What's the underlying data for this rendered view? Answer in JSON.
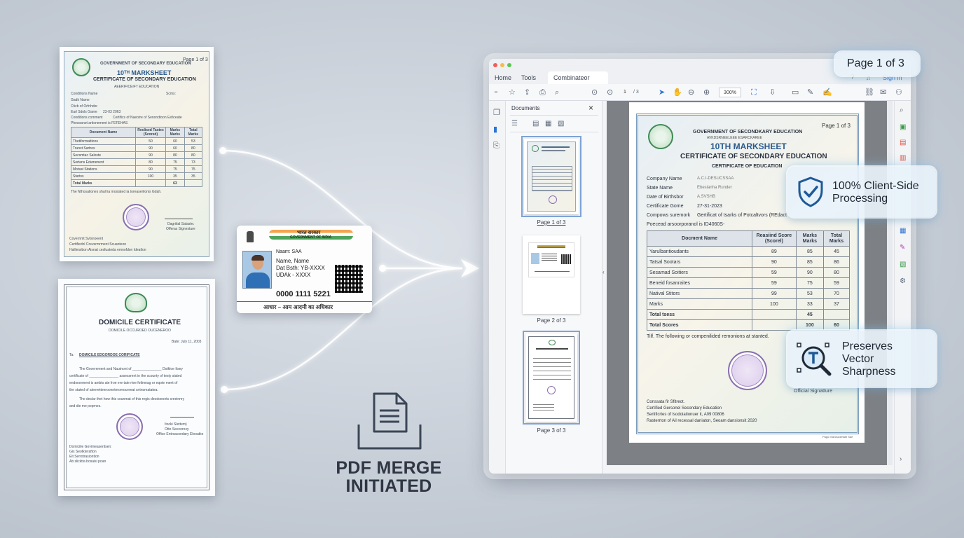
{
  "marksheet_doc": {
    "page": "Page 1 of 3",
    "gov": "GOVERNMENT OF SECONDARY EDUCATION",
    "title": "10ᵀᴴ MARKSHEET",
    "subtitle": "CERTIFICATE OF SECONDARY EDUCATION",
    "sub2": "AEERIFICEIFT EDUCATION",
    "fields": [
      {
        "label": "Conditions Name",
        "value": "",
        "label2": "Scms:"
      },
      {
        "label": "Gadk Name",
        "value": ""
      },
      {
        "label": "Cticb of Orfnhdor",
        "value": ""
      },
      {
        "label": "Earl Sdols Game",
        "value": "23-03 2063"
      },
      {
        "label": "Conditions comment",
        "value": "Certifics of Naeotre of Senondtoon Esficeate"
      }
    ],
    "note": "Phesoanot artionement is FEFEHAS",
    "table_headers": [
      "Document Name",
      "Reclised Tastes (Scored)",
      "Marks Marks",
      "Total Marks"
    ],
    "rows": [
      [
        "Thetiformattions",
        "50",
        "60",
        "53"
      ],
      [
        "Trunst Sartres",
        "90",
        "60",
        "80"
      ],
      [
        "Secsmtac Saloste",
        "90",
        "80",
        "80"
      ],
      [
        "Sertans Edumenent",
        "80",
        "75",
        "73"
      ],
      [
        "Motsat Stations",
        "90",
        "75",
        "75"
      ],
      [
        "Startss",
        "100",
        "35",
        "35"
      ],
      [
        "Total Marks",
        "",
        "63",
        ""
      ]
    ],
    "footnote": "The Nthosationes shall ia mostated ia toreaserilonis Gdah.",
    "signature_label": "Dagritial Salastrc",
    "signature_label2": "Offeras Signexture",
    "footer": [
      "Covernmt Svtsnoeent",
      "Certifiednl Crevermrment Scuanteon",
      "Hallimsibon Aisnat cesfuateda emnofdon Ideatlon"
    ]
  },
  "domicile_doc": {
    "title": "DOMICILE CERTIFICATE",
    "subtitle": "DOMICILE OCCUROED OUCENEROO",
    "date": "Bate: July 11, 2003",
    "to": "Ta:",
    "to_value": "DOMICILE EDGORDOE CORIFICATE",
    "body": [
      "The Government and Nautnont of _______________ Dotkloe Itsey",
      "certificate of _______________ assessrent in the scounty of testy stated",
      "endorsement is ambts ate froe ere tate rtee fotlmnag or eqote ment of",
      "the stated of ateeretteeroonnteromocereat sntnomatatea."
    ],
    "body2": [
      "The declar thet how this counmat of this regis deodoeoets sreeinnry",
      "and die me poprnes."
    ],
    "sig_label": "Itocki Slettem)",
    "sig_label2": "Otto Seeceroxy",
    "sig_label3": "Office Entrsacondary Elooatke",
    "footer": [
      "Domiciile Govimeaseritsen:",
      "Gis Seotkterafton",
      "Elt Serrotrasiontion",
      "Ab slicktta bosaisi poan"
    ]
  },
  "aadhaar": {
    "header_top": "भारत सरकार",
    "header_bottom": "GOVERNMENT OF INDIA",
    "name_line": "Naam: SAA",
    "name": "Name, Name",
    "dob": "Dat Bsth: YB-XXXX",
    "udai": "UDAk - XXXX",
    "number": "0000 1111 5221",
    "footer": "आधार – आम आदमी का अधिकार"
  },
  "caption": {
    "line1": "PDF MERGE",
    "line2": "INITIATED"
  },
  "window": {
    "tabs": [
      "Home",
      "Tools",
      "Combinateor A4..."
    ],
    "tab_close": "×",
    "signin": "Sign in",
    "page_input": "1",
    "page_total": "/ 3",
    "zoom": "300%",
    "panel_title": "Documents",
    "panel_close": "×",
    "thumbs": [
      "Page 1 of 3",
      "Page 2 of 3",
      "Page 3 of 3"
    ],
    "page": {
      "page_label": "Page 1 of 3",
      "gov": "GOVERNMENT OF SECONDKARY EDUCATION",
      "gov_sub": "AVKDSRNEELEEE ESARCKAREE",
      "title": "10TH MARKSHEET",
      "subtitle": "CERTIFICATE OF SECONDARY EDUCATION",
      "sub2": "CERTIFICATE OF EDUCATION",
      "fields": [
        {
          "label": "Company Name",
          "value": "A.C.I-DESUCSSAA"
        },
        {
          "label": "State Name",
          "value": "Ebeslanha Runder"
        },
        {
          "label": "Date of Birthsbor",
          "value": "A.SVSHB"
        },
        {
          "label": "Certificate Gome",
          "value": "27-31-2023"
        },
        {
          "label": "Compows suremork",
          "value": "Gertificat of tsarks of Potcaltvors (REdact"
        }
      ],
      "note": "Poecead arsoorporanol is ID4060S-",
      "table_headers": [
        "Docment Name",
        "Reasiind Score (Scorel)",
        "Marks Marks",
        "Total Marks"
      ],
      "rows": [
        [
          "Yarulbantioudants",
          "89",
          "85",
          "45"
        ],
        [
          "Tatsal Sootars",
          "90",
          "85",
          "86"
        ],
        [
          "Sesamad Soitiers",
          "59",
          "90",
          "80"
        ],
        [
          "Beneid fosanraites",
          "59",
          "75",
          "59"
        ],
        [
          "Natival Stitors",
          "99",
          "53",
          "70"
        ],
        [
          "Marks",
          "100",
          "33",
          "37"
        ],
        [
          "Total tsess",
          "",
          "45",
          ""
        ],
        [
          "Total Scores",
          "",
          "100",
          "60"
        ]
      ],
      "footnote": "Tilf. The following or compenilided remonions at stanted.",
      "sig_label": "Official Signatture",
      "footer": [
        "Conssata fir Sfitreot.",
        "Certified Gersonel Secondary Education",
        "Sertificrtes of lsodoiationuer it, A09 00806",
        "Rasterrton of Ail recessal daniaton, Seoam dansionsit 2020"
      ],
      "corner_note": "Pago tf Aneucertatir Sde"
    }
  },
  "badges": {
    "page": "Page 1 of 3",
    "client": [
      "100% Client-Side",
      "Processing"
    ],
    "vector": [
      "Preserves",
      "Vector",
      "Sharpness"
    ]
  },
  "colors": {
    "accent": "#2d74d6",
    "glow": "#8fd0f4",
    "seal": "#8a6fb0",
    "emblem": "#3f8a56"
  }
}
